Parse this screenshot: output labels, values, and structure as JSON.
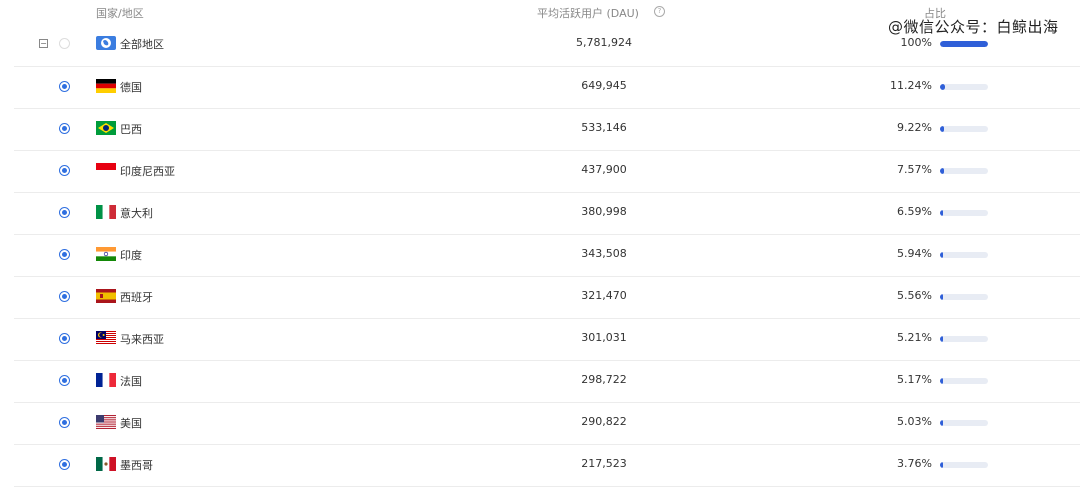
{
  "header": {
    "country_label": "国家/地区",
    "dau_label": "平均活跃用户 (DAU)",
    "help_icon": "?",
    "share_label": "占比"
  },
  "watermark": "@微信公众号：白鲸出海",
  "total": {
    "collapse_glyph": "−",
    "name": "全部地区",
    "dau": "5,781,924",
    "pct": "100%",
    "share": 1.0
  },
  "rows": [
    {
      "flag": "de",
      "name": "德国",
      "dau": "649,945",
      "pct": "11.24%",
      "share": 0.1124
    },
    {
      "flag": "br",
      "name": "巴西",
      "dau": "533,146",
      "pct": "9.22%",
      "share": 0.0922
    },
    {
      "flag": "id",
      "name": "印度尼西亚",
      "dau": "437,900",
      "pct": "7.57%",
      "share": 0.0757
    },
    {
      "flag": "it",
      "name": "意大利",
      "dau": "380,998",
      "pct": "6.59%",
      "share": 0.0659
    },
    {
      "flag": "in",
      "name": "印度",
      "dau": "343,508",
      "pct": "5.94%",
      "share": 0.0594
    },
    {
      "flag": "es",
      "name": "西班牙",
      "dau": "321,470",
      "pct": "5.56%",
      "share": 0.0556
    },
    {
      "flag": "my",
      "name": "马来西亚",
      "dau": "301,031",
      "pct": "5.21%",
      "share": 0.0521
    },
    {
      "flag": "fr",
      "name": "法国",
      "dau": "298,722",
      "pct": "5.17%",
      "share": 0.0517
    },
    {
      "flag": "us",
      "name": "美国",
      "dau": "290,822",
      "pct": "5.03%",
      "share": 0.0503
    },
    {
      "flag": "mx",
      "name": "墨西哥",
      "dau": "217,523",
      "pct": "3.76%",
      "share": 0.0376
    }
  ]
}
